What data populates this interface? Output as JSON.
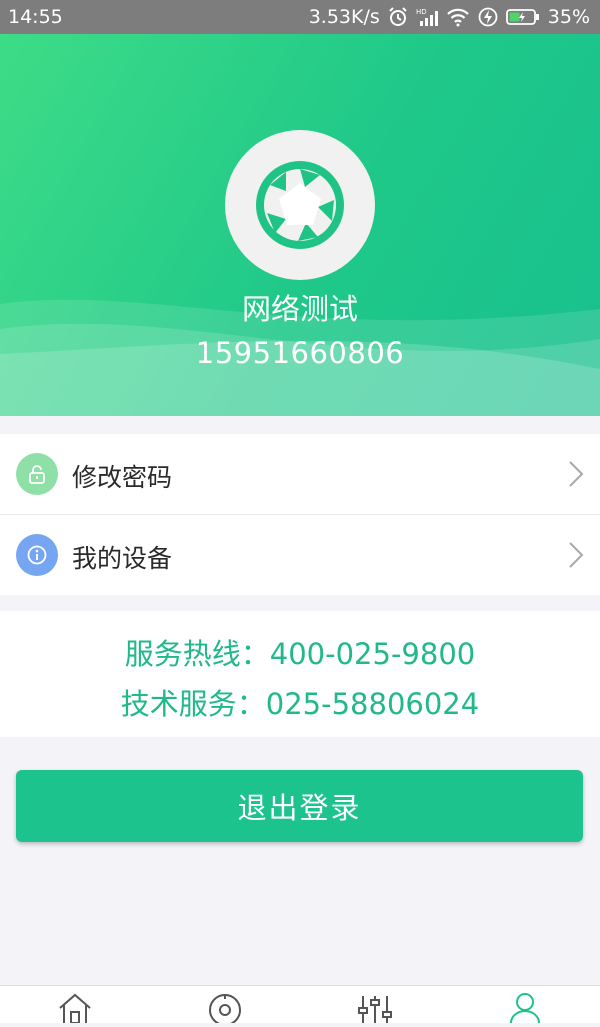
{
  "status_bar": {
    "time": "14:55",
    "network_speed": "3.53K/s",
    "battery": "35%",
    "icons": [
      "alarm-icon",
      "hd-signal-icon",
      "wifi-icon",
      "charging-icon",
      "battery-icon"
    ]
  },
  "profile": {
    "name": "网络测试",
    "phone": "15951660806",
    "avatar_icon": "aperture-logo-icon"
  },
  "menu": {
    "items": [
      {
        "label": "修改密码",
        "icon": "lock-icon",
        "icon_color": "#8ee0a6"
      },
      {
        "label": "我的设备",
        "icon": "info-icon",
        "icon_color": "#76a6f2"
      }
    ]
  },
  "hotline": {
    "service": "服务热线：400-025-9800",
    "tech": "技术服务：025-58806024"
  },
  "logout_label": "退出登录",
  "bottom_nav": [
    "home-icon",
    "device-icon",
    "settings-sliders-icon",
    "profile-icon"
  ],
  "colors": {
    "accent": "#1dc38c",
    "hotline_text": "#21b88a",
    "header_gradient_start": "#3ddc87",
    "header_gradient_end": "#18c08e"
  }
}
